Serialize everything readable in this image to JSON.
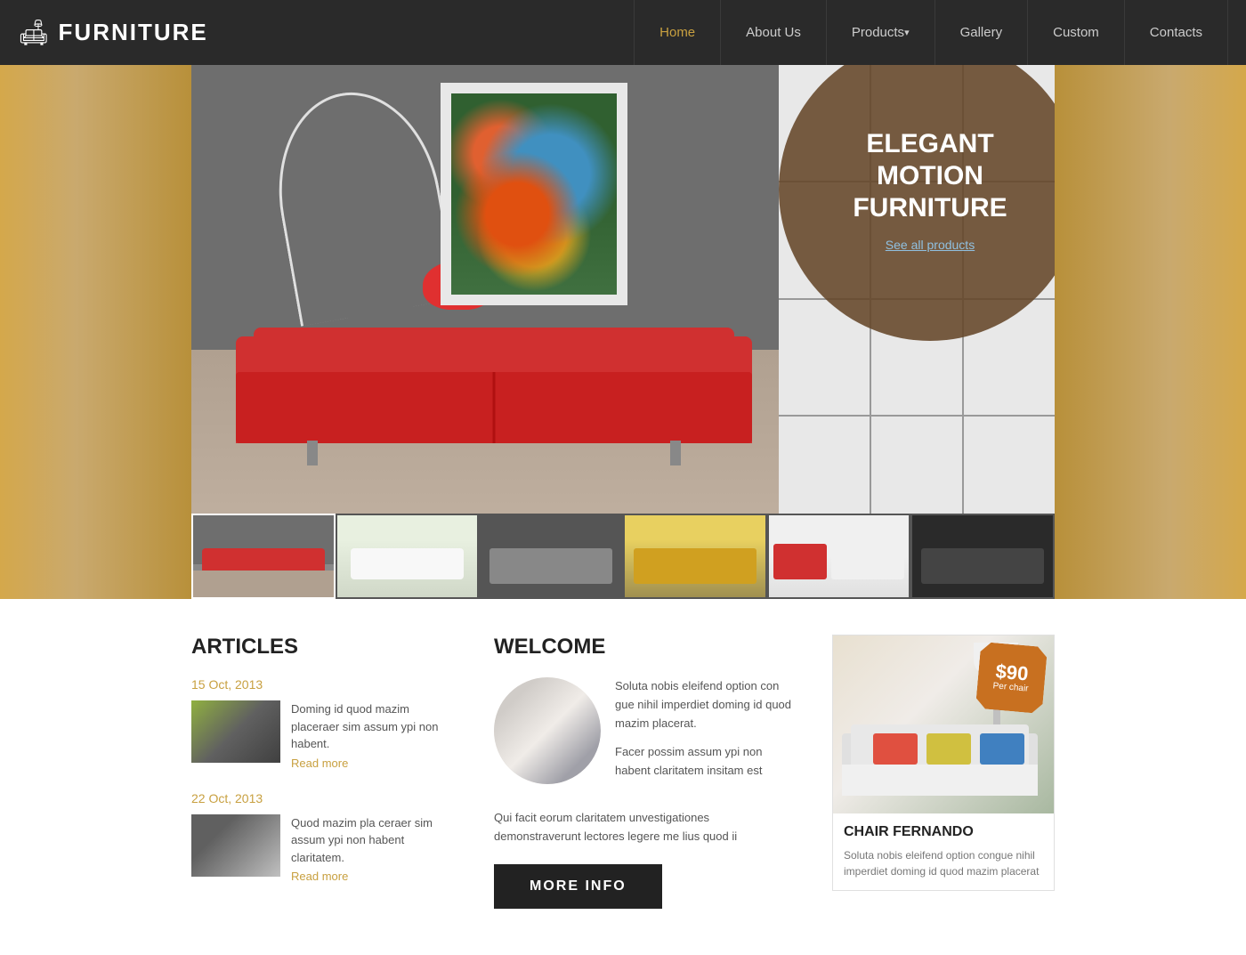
{
  "header": {
    "logo_icon": "🛋",
    "logo_text": "FURNITURE",
    "nav": [
      {
        "label": "Home",
        "active": true,
        "id": "home"
      },
      {
        "label": "About Us",
        "active": false,
        "id": "about"
      },
      {
        "label": "Products",
        "active": false,
        "id": "products",
        "dropdown": true
      },
      {
        "label": "Gallery",
        "active": false,
        "id": "gallery"
      },
      {
        "label": "Custom",
        "active": false,
        "id": "custom"
      },
      {
        "label": "Contacts",
        "active": false,
        "id": "contacts"
      }
    ]
  },
  "hero": {
    "tagline_line1": "ELEGANT",
    "tagline_line2": "MOTION",
    "tagline_line3": "FURNITURE",
    "see_all": "See all products"
  },
  "articles": {
    "section_title": "ARTICLES",
    "items": [
      {
        "date": "15 Oct, 2013",
        "text": "Doming id quod mazim placeraer sim assum ypi non habent.",
        "read_more": "Read more"
      },
      {
        "date": "22 Oct, 2013",
        "text": "Quod mazim pla ceraer sim assum ypi non habent claritatem.",
        "read_more": "Read more"
      }
    ]
  },
  "welcome": {
    "section_title": "WELCOME",
    "para1": "Soluta nobis eleifend option con gue nihil imperdiet doming id quod mazim placerat.",
    "para2": "Facer possim assum ypi non habent claritatem insitam est",
    "bottom_text": "Qui facit eorum claritatem unvestigationes demonstraverunt lectores legere me lius quod ii",
    "more_info": "MORE INFO"
  },
  "product": {
    "price_amount": "$90",
    "price_label": "Per chair",
    "name": "CHAIR FERNANDO",
    "desc": "Soluta nobis eleifend option congue nihil imperdiet doming id quod mazim placerat"
  }
}
